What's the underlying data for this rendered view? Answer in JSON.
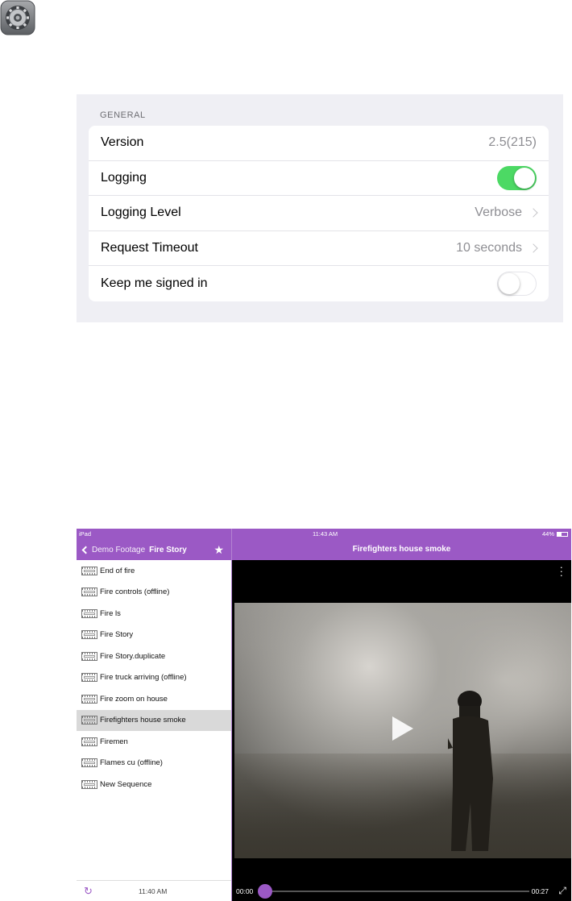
{
  "settings": {
    "section_header": "GENERAL",
    "rows": [
      {
        "label": "Version",
        "value": "2.5(215)"
      },
      {
        "label": "Logging",
        "toggle": "on"
      },
      {
        "label": "Logging Level",
        "value": "Verbose"
      },
      {
        "label": "Request Timeout",
        "value": "10 seconds"
      },
      {
        "label": "Keep me signed in",
        "toggle": "off"
      }
    ],
    "toggle_on_color": "#4cd964"
  },
  "ipad": {
    "status": {
      "device": "iPad",
      "time": "11:43 AM",
      "battery": "44%"
    },
    "left_nav": {
      "back_label": "Demo Footage",
      "title": "Fire Story"
    },
    "right_nav": {
      "title": "Firefighters house smoke"
    },
    "clips": [
      {
        "name": "End of fire"
      },
      {
        "name": "Fire controls (offline)"
      },
      {
        "name": "Fire ls"
      },
      {
        "name": "Fire Story"
      },
      {
        "name": "Fire Story.duplicate"
      },
      {
        "name": "Fire truck arriving (offline)"
      },
      {
        "name": "Fire zoom on house"
      },
      {
        "name": "Firefighters house smoke",
        "selected": true
      },
      {
        "name": "Firemen"
      },
      {
        "name": "Flames cu (offline)"
      },
      {
        "name": "New Sequence"
      }
    ],
    "footer_time": "11:40 AM",
    "player": {
      "time_start": "00:00",
      "time_end": "00:27",
      "progress": 0
    },
    "accent_color": "#9b59c5",
    "icons": [
      "settings-app-icon",
      "chevron-right-icon",
      "back-chevron-icon",
      "star-icon",
      "film-strip-icon",
      "refresh-icon",
      "more-icon",
      "play-icon",
      "fullscreen-icon"
    ]
  }
}
